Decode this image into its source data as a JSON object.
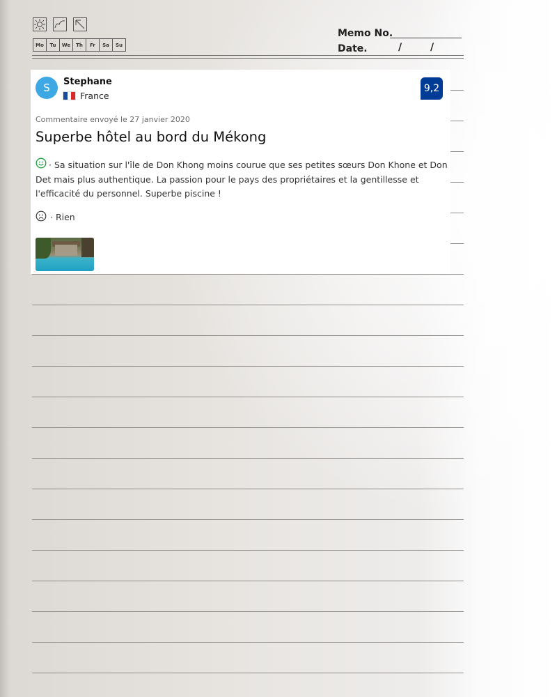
{
  "memo": {
    "icons": [
      "sun-icon",
      "cloud-icon",
      "umbrella-icon"
    ],
    "days": [
      "Mo",
      "Tu",
      "We",
      "Th",
      "Fr",
      "Sa",
      "Su"
    ],
    "memo_label": "Memo No.",
    "date_label": "Date.",
    "date_sep_1": "/",
    "date_sep_2": "/"
  },
  "review": {
    "avatar_initial": "S",
    "username": "Stephane",
    "country": "France",
    "flag_colors": [
      "#1a4aa0",
      "#ffffff",
      "#d62b2b"
    ],
    "score": "9,2",
    "score_color": "#003b95",
    "sent_date": "Commentaire envoyé le 27 janvier 2020",
    "title": "Superbe hôtel au bord du Mékong",
    "positive_text": "· Sa situation sur l'île de Don Khong moins courue que ses petites sœurs Don Khone et Don Det mais plus authentique. La passion pour le pays des propriétaires et la gentillesse et l'efficacité du personnel. Superbe piscine !",
    "negative_text": "· Rien",
    "positive_icon": "smiley-happy-icon",
    "negative_icon": "smiley-sad-icon",
    "positive_color": "#1a9e3a"
  }
}
